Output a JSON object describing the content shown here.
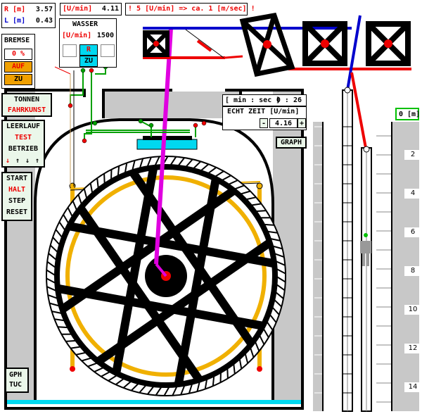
{
  "readouts": {
    "r_label": "R [m]",
    "r_value": "3.57",
    "l_label": "L [m]",
    "l_value": "0.43",
    "speed_label": "[U/min]",
    "speed_value": "4.11",
    "warning": "! 5 [U/min] => ca. 1 [m/sec] !"
  },
  "brake": {
    "title": "BREMSE",
    "percent": "0 %",
    "open": "AUF",
    "close": "ZU"
  },
  "water": {
    "title": "WASSER",
    "unit": "[U/min]",
    "value": "1500",
    "r": "R",
    "zu": "ZU"
  },
  "mode": {
    "tonnen": "TONNEN",
    "fahrkunst": "FAHRKUNST"
  },
  "drive": {
    "leerlauf": "LEERLAUF",
    "test": "TEST",
    "betrieb": "BETRIEB",
    "arrows": [
      "↓",
      "↑",
      "↓",
      "↑"
    ]
  },
  "control": {
    "start": "START",
    "halt": "HALT",
    "step": "STEP",
    "reset": "RESET"
  },
  "logo": {
    "line1": "GPH",
    "line2": "TUC"
  },
  "timer": {
    "label": "[ min : sec ]",
    "value": "0 : 26"
  },
  "realtime": {
    "label": "ECHT ZEIT [U/min]",
    "minus": "-",
    "value": "4.16",
    "plus": "+"
  },
  "graph_button": "GRAPH",
  "depth": {
    "zero_label": "0 [m]",
    "marks": [
      "2",
      "4",
      "6",
      "8",
      "10",
      "12",
      "14"
    ]
  },
  "colors": {
    "panel_bg": "#ebf7ea",
    "accent_red": "#e00000",
    "rod": "#e000e0",
    "rim_yellow": "#f0b000",
    "cyan": "#00d8f0",
    "green": "#00a000",
    "blue": "#0000cc",
    "orange": "#f0a000"
  }
}
